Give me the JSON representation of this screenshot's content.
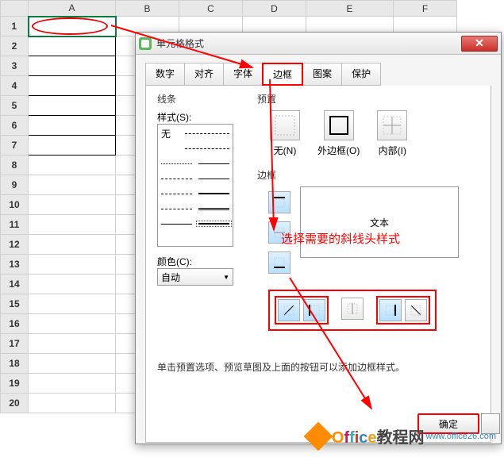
{
  "sheet": {
    "columns": [
      "A",
      "B",
      "C",
      "D",
      "E",
      "F"
    ],
    "row_count": 20
  },
  "dialog": {
    "title": "单元格格式",
    "tabs": {
      "number": "数字",
      "align": "对齐",
      "font": "字体",
      "border": "边框",
      "pattern": "图案",
      "protect": "保护"
    },
    "line_section": "线条",
    "style_label": "样式(S):",
    "none_label": "无",
    "color_label": "颜色(C):",
    "color_value": "自动",
    "preset_section": "预置",
    "presets": {
      "none": "无(N)",
      "outer": "外边框(O)",
      "inner": "内部(I)"
    },
    "border_section": "边框",
    "preview_text": "文本",
    "hint": "单击预置选项、预览草图及上面的按钮可以添加边框样式。",
    "ok": "确定"
  },
  "annotation": "选择需要的斜线头样式",
  "watermark": {
    "text": "Office教程网",
    "domain": "www.office26.com"
  }
}
